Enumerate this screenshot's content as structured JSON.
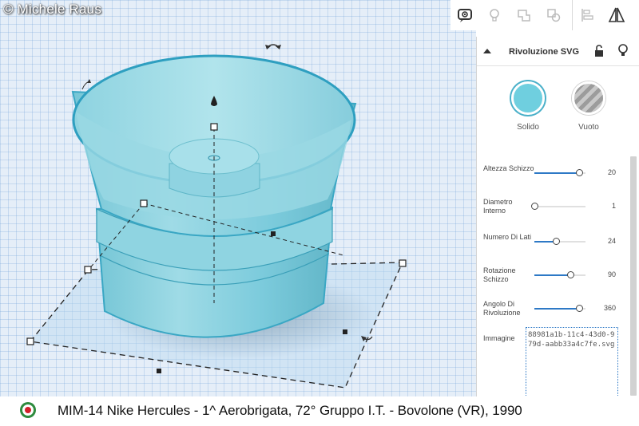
{
  "watermark": "© Michele Raus",
  "toolbar": {
    "icons": [
      "notes-icon",
      "lightbulb-icon",
      "group-icon",
      "ungroup-icon",
      "align-icon",
      "mirror-icon"
    ]
  },
  "panel": {
    "title": "Rivoluzione SVG",
    "modes": {
      "solid": "Solido",
      "hole": "Vuoto"
    },
    "solid_color": "#6fcfdf",
    "properties": [
      {
        "label": "Altezza Schizzo",
        "value": "20",
        "fraction": 0.88
      },
      {
        "label": "Diametro Interno",
        "value": "1",
        "fraction": 0.0
      },
      {
        "label": "Numero Di Lati",
        "value": "24",
        "fraction": 0.42
      },
      {
        "label": "Rotazione Schizzo",
        "value": "90",
        "fraction": 0.7
      },
      {
        "label": "Angolo Di Rivoluzione",
        "value": "360",
        "fraction": 0.88
      }
    ],
    "image_label": "Immagine",
    "image_value": "88981a1b-11c4-43d0-979d-aabb33a4c7fe.svg"
  },
  "caption": "MIM-14 Nike Hercules - 1^ Aerobrigata, 72° Gruppo I.T. - Bovolone (VR), 1990"
}
